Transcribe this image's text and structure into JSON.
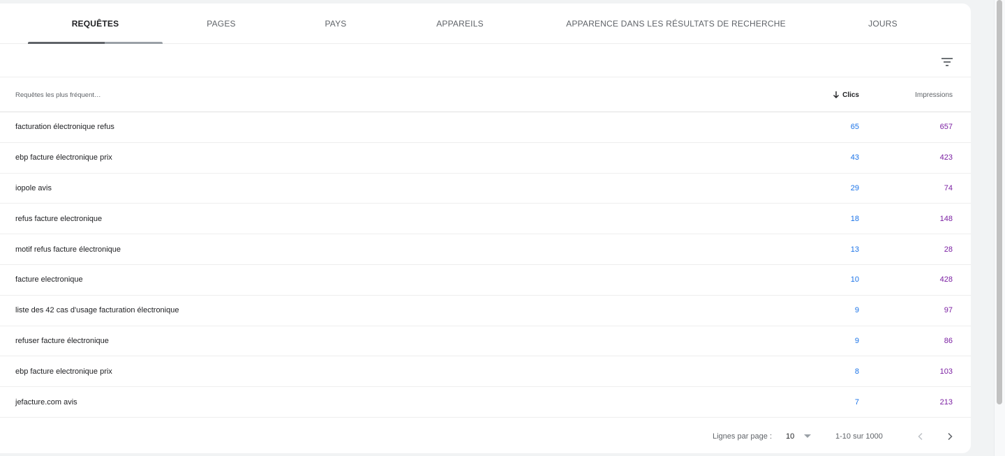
{
  "tabs": [
    {
      "label": "REQUÊTES",
      "active": true
    },
    {
      "label": "PAGES",
      "active": false
    },
    {
      "label": "PAYS",
      "active": false
    },
    {
      "label": "APPAREILS",
      "active": false
    },
    {
      "label": "APPARENCE DANS LES RÉSULTATS DE RECHERCHE",
      "active": false
    },
    {
      "label": "JOURS",
      "active": false
    }
  ],
  "toolbar": {
    "filter_icon": "filter-list-icon"
  },
  "table": {
    "columns": {
      "query": "Requêtes les plus fréquent…",
      "clicks": "Clics",
      "impressions": "Impressions",
      "sort_icon": "arrow-down-icon"
    },
    "rows": [
      {
        "query": "facturation électronique refus",
        "clicks": "65",
        "impressions": "657"
      },
      {
        "query": "ebp facture électronique prix",
        "clicks": "43",
        "impressions": "423"
      },
      {
        "query": "iopole avis",
        "clicks": "29",
        "impressions": "74"
      },
      {
        "query": "refus facture electronique",
        "clicks": "18",
        "impressions": "148"
      },
      {
        "query": "motif refus facture électronique",
        "clicks": "13",
        "impressions": "28"
      },
      {
        "query": "facture electronique",
        "clicks": "10",
        "impressions": "428"
      },
      {
        "query": "liste des 42 cas d'usage facturation électronique",
        "clicks": "9",
        "impressions": "97"
      },
      {
        "query": "refuser facture électronique",
        "clicks": "9",
        "impressions": "86"
      },
      {
        "query": "ebp facture electronique prix",
        "clicks": "8",
        "impressions": "103"
      },
      {
        "query": "jefacture.com avis",
        "clicks": "7",
        "impressions": "213"
      }
    ]
  },
  "pagination": {
    "rows_per_page_label": "Lignes par page :",
    "rows_per_page_value": "10",
    "range": "1-10 sur 1000"
  },
  "colors": {
    "clicks": "#1a73e8",
    "impressions": "#7b1fa2"
  }
}
